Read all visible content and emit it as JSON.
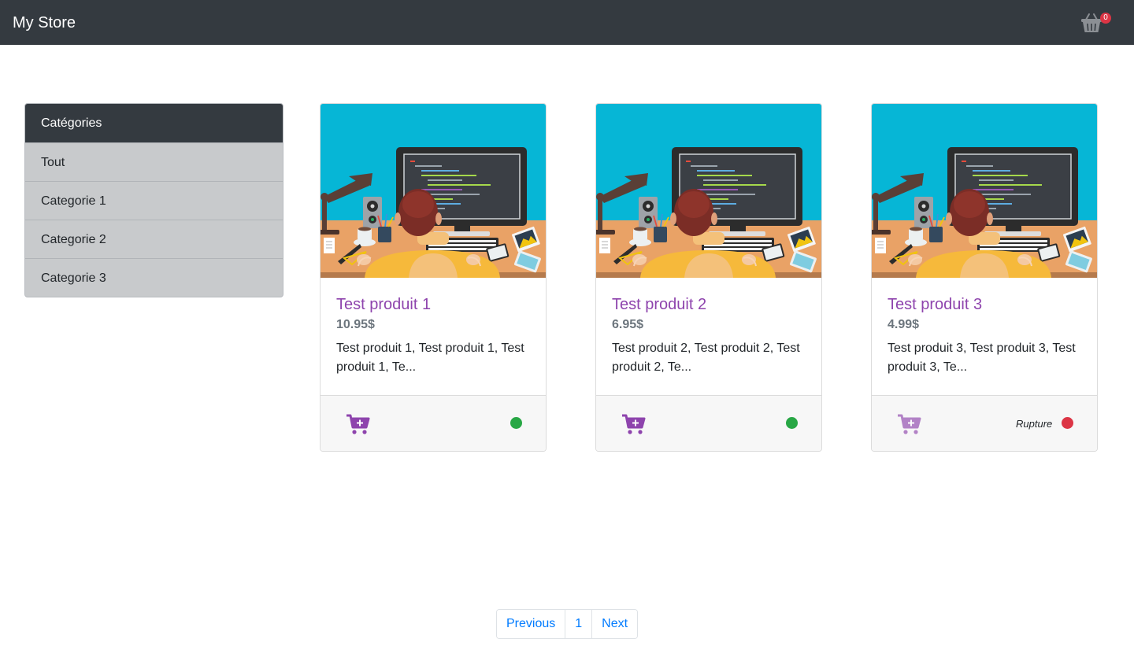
{
  "navbar": {
    "brand": "My Store",
    "cart_count": "0"
  },
  "sidebar": {
    "header": "Catégories",
    "items": [
      {
        "label": "Tout"
      },
      {
        "label": "Categorie 1"
      },
      {
        "label": "Categorie 2"
      },
      {
        "label": "Categorie 3"
      }
    ]
  },
  "products": [
    {
      "title": "Test produit 1",
      "price": "10.95$",
      "description": "Test produit 1, Test produit 1, Test produit 1, Te...",
      "in_stock": true,
      "status_label": "",
      "status_color": "#28a745"
    },
    {
      "title": "Test produit 2",
      "price": "6.95$",
      "description": "Test produit 2, Test produit 2, Test produit 2, Te...",
      "in_stock": true,
      "status_label": "",
      "status_color": "#28a745"
    },
    {
      "title": "Test produit 3",
      "price": "4.99$",
      "description": "Test produit 3, Test produit 3, Test produit 3, Te...",
      "in_stock": false,
      "status_label": "Rupture",
      "status_color": "#dc3545"
    }
  ],
  "pagination": {
    "previous": "Previous",
    "page": "1",
    "next": "Next"
  },
  "colors": {
    "navbar": "#343a40",
    "accent": "#8e44ad",
    "link": "#007bff",
    "in_stock": "#28a745",
    "out_of_stock": "#dc3545"
  }
}
